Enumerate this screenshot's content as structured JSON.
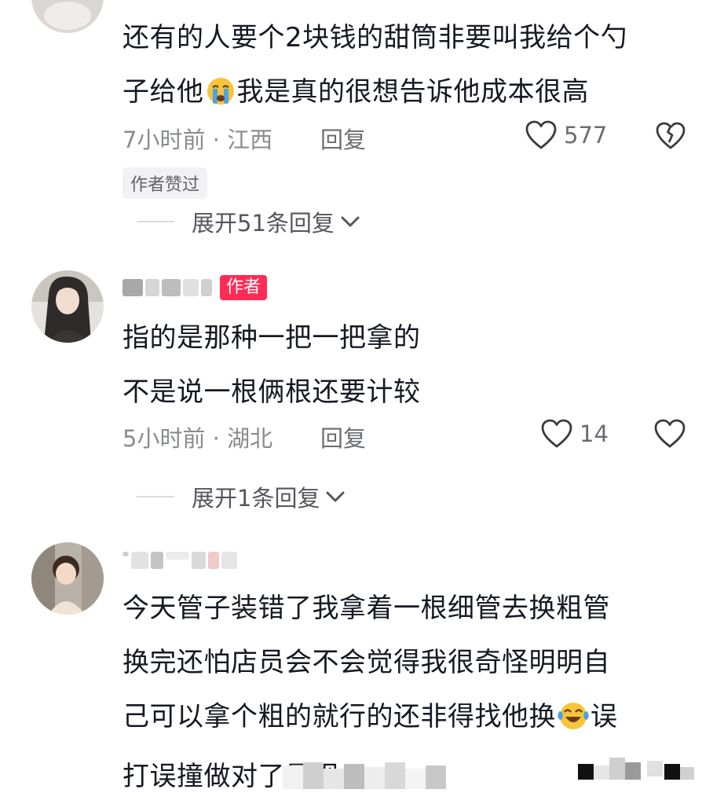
{
  "comments": [
    {
      "text_lines": [
        "还有的人要个2块钱的甜筒非要叫我给个勺",
        "子给他",
        "我是真的很想告诉他成本很高"
      ],
      "time": "7小时前",
      "location": "江西",
      "reply_label": "回复",
      "likes": "577",
      "author_liked": "作者赞过",
      "expand": "展开51条回复"
    },
    {
      "badge": "作者",
      "text_lines": [
        "指的是那种一把一把拿的",
        "不是说一根俩根还要计较"
      ],
      "time": "5小时前",
      "location": "湖北",
      "reply_label": "回复",
      "likes": "14",
      "expand": "展开1条回复"
    },
    {
      "text_lines": [
        "今天管子装错了我拿着一根细管去换粗管",
        "换完还怕店员会不会觉得我很奇怪明明自",
        "己可以拿个粗的就行的还非得找他换",
        "误",
        "打误撞做对了是呗"
      ]
    }
  ],
  "meta_separator": " · ",
  "colors": {
    "author_badge": "#fe2c55",
    "text": "#161823",
    "meta": "#8a8b91"
  },
  "icons": [
    "heart-outline-icon",
    "broken-heart-icon",
    "chevron-down-icon",
    "crying-emoji-icon",
    "laughing-crying-emoji-icon"
  ]
}
